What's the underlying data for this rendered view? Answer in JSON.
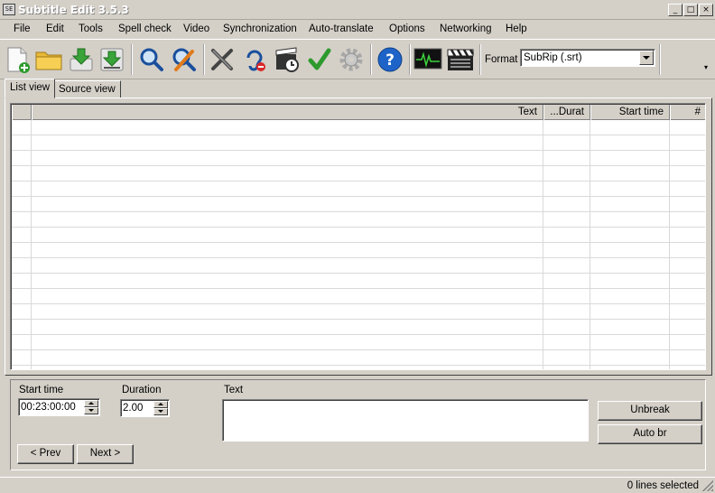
{
  "window": {
    "title": "Subtitle Edit 3.5.3",
    "icon_text": "SE",
    "min": "_",
    "max": "□",
    "close": "×"
  },
  "menu": [
    {
      "label": "File"
    },
    {
      "label": "Edit"
    },
    {
      "label": "Tools"
    },
    {
      "label": "Spell check"
    },
    {
      "label": "Video"
    },
    {
      "label": "Synchronization"
    },
    {
      "label": "Auto-translate"
    },
    {
      "label": "Options"
    },
    {
      "label": "Networking"
    },
    {
      "label": "Help"
    }
  ],
  "toolbar": {
    "buttons": [
      {
        "name": "new-file-icon"
      },
      {
        "name": "open-folder-icon"
      },
      {
        "name": "save-icon"
      },
      {
        "name": "save-as-icon"
      },
      {
        "name": "find-icon"
      },
      {
        "name": "replace-icon"
      },
      {
        "name": "fix-common-errors-icon"
      },
      {
        "name": "remove-text-for-hearing-impaired-icon"
      },
      {
        "name": "visual-sync-icon"
      },
      {
        "name": "spell-check-icon"
      },
      {
        "name": "settings-gear-icon"
      },
      {
        "name": "help-icon"
      },
      {
        "name": "waveform-icon"
      },
      {
        "name": "video-clapper-icon"
      }
    ],
    "format_label": "Format",
    "format_value": "SubRip (.srt)",
    "overflow": "▾"
  },
  "tabs": [
    {
      "label": "List view",
      "active": true
    },
    {
      "label": "Source view",
      "active": false
    }
  ],
  "grid": {
    "columns": [
      {
        "label": ""
      },
      {
        "label": "Text"
      },
      {
        "label": "...Durat"
      },
      {
        "label": "Start time"
      },
      {
        "label": "#"
      }
    ],
    "rows": []
  },
  "edit": {
    "start_time_label": "Start time",
    "start_time_value": "00:23:00:00",
    "duration_label": "Duration",
    "duration_value": "2.00",
    "text_label": "Text",
    "text_value": "",
    "prev_button": "< Prev",
    "next_button": "Next >",
    "unbreak_button": "Unbreak",
    "auto_br_button": "Auto br"
  },
  "status": {
    "text": "0 lines selected"
  },
  "colors": {
    "face": "#d4d0c8",
    "help_blue": "#1e64c8",
    "check_green": "#2e9a2e"
  }
}
